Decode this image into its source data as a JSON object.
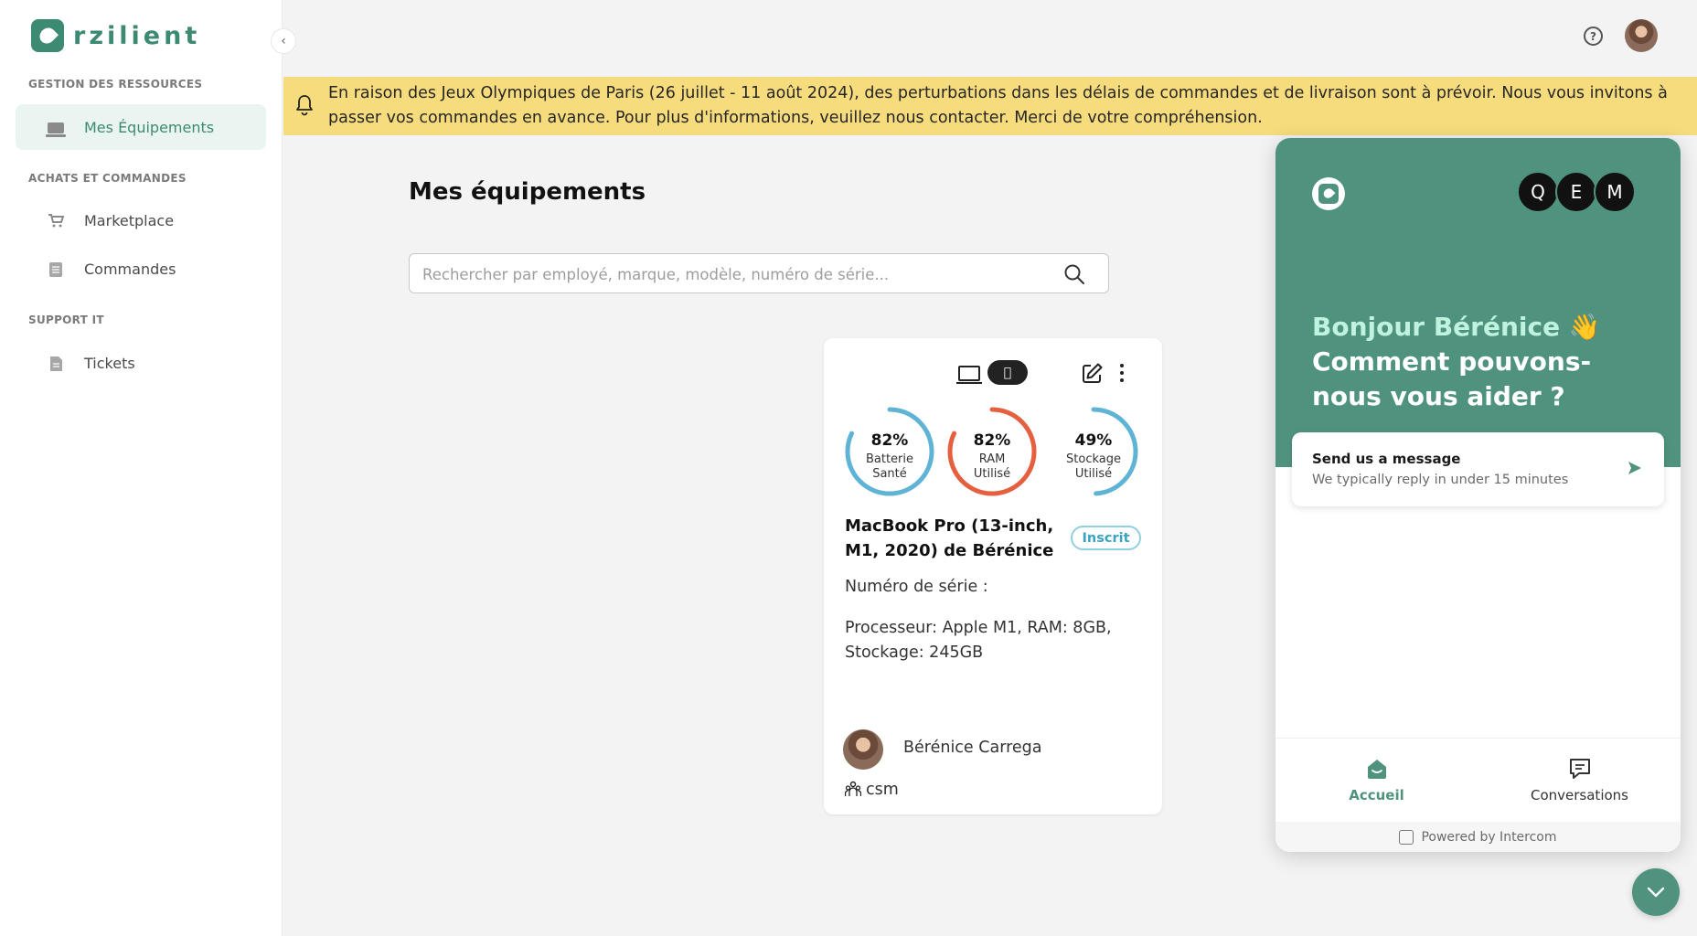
{
  "app": {
    "logo_text": "rzilient"
  },
  "sidebar": {
    "sections": [
      {
        "title": "GESTION DES RESSOURCES"
      },
      {
        "title": "ACHATS ET COMMANDES"
      },
      {
        "title": "SUPPORT IT"
      }
    ],
    "items": [
      {
        "label": "Mes Équipements",
        "icon": "laptop-icon",
        "active": true
      },
      {
        "label": "Marketplace",
        "icon": "cart-icon"
      },
      {
        "label": "Commandes",
        "icon": "list-icon"
      },
      {
        "label": "Tickets",
        "icon": "document-icon"
      }
    ]
  },
  "banner": {
    "icon": "bell-icon",
    "text": "En raison des Jeux Olympiques de Paris (26 juillet - 11 août 2024), des perturbations dans les délais de commandes et de livraison sont à prévoir. Nous vous invitons à passer vos commandes en avance. Pour plus d'informations, veuillez nous contacter. Merci de votre compréhension."
  },
  "main": {
    "title": "Mes équipements",
    "search": {
      "placeholder": "Rechercher par employé, marque, modèle, numéro de série...",
      "value": ""
    }
  },
  "device_card": {
    "name": "MacBook Pro (13-inch, M1, 2020) de Bérénice",
    "status": "Inscrit",
    "os_icon": "apple-icon",
    "serial_label": "Numéro de série :",
    "specs": "Processeur: Apple M1, RAM: 8GB, Stockage: 245GB",
    "gauges": [
      {
        "pct": "82%",
        "line1": "Batterie",
        "line2": "Santé",
        "value": 82,
        "color": "#5fb3d4"
      },
      {
        "pct": "82%",
        "line1": "RAM",
        "line2": "Utilisé",
        "value": 82,
        "color": "#e4603e"
      },
      {
        "pct": "49%",
        "line1": "Stockage",
        "line2": "Utilisé",
        "value": 49,
        "color": "#5fb3d4"
      }
    ],
    "owner": "Bérénice Carrega",
    "team": "csm"
  },
  "messenger": {
    "greeting_line1": "Bonjour Bérénice 👋",
    "greeting_line2": "Comment pouvons-nous vous aider ?",
    "team_avatars": [
      "Q",
      "E",
      "M"
    ],
    "message_card": {
      "title": "Send us a message",
      "subtitle": "We typically reply in under 15 minutes"
    },
    "tabs": [
      {
        "label": "Accueil",
        "active": true
      },
      {
        "label": "Conversations",
        "active": false
      }
    ],
    "powered_by": "Powered by Intercom",
    "colors": {
      "header": "#4f937e",
      "accent": "#4f937e"
    }
  }
}
